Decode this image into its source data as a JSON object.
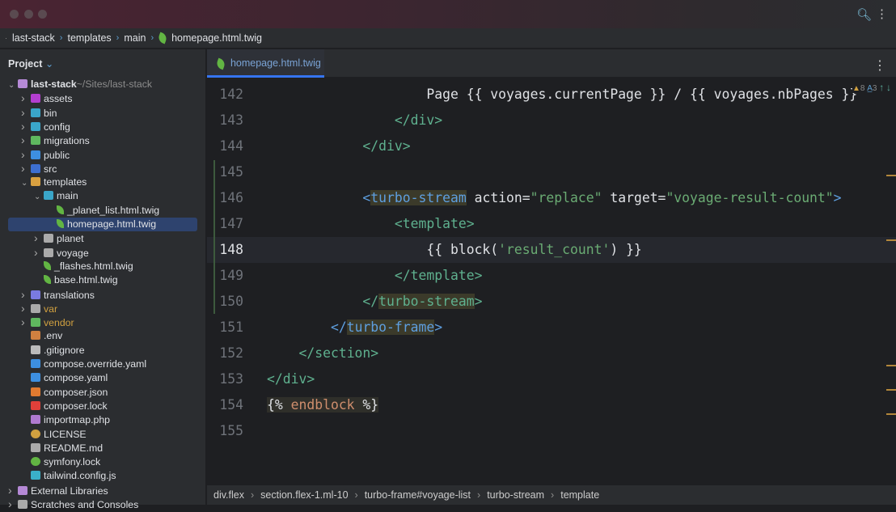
{
  "breadcrumb": [
    "last-stack",
    "templates",
    "main",
    "homepage.html.twig"
  ],
  "sidebar": {
    "title": "Project",
    "items": [
      {
        "label": "last-stack",
        "hint": "~/Sites/last-stack",
        "depth": 0,
        "chev": "v",
        "icon": "folder-icon",
        "color": "#b589d6",
        "bold": true
      },
      {
        "label": "assets",
        "depth": 1,
        "chev": ">",
        "icon": "folder-icon",
        "color": "#b33ecf"
      },
      {
        "label": "bin",
        "depth": 1,
        "chev": ">",
        "icon": "folder-icon",
        "color": "#3aa6c9"
      },
      {
        "label": "config",
        "depth": 1,
        "chev": ">",
        "icon": "folder-icon",
        "color": "#3aa6c9"
      },
      {
        "label": "migrations",
        "depth": 1,
        "chev": ">",
        "icon": "folder-icon",
        "color": "#5fb85f"
      },
      {
        "label": "public",
        "depth": 1,
        "chev": ">",
        "icon": "folder-icon",
        "color": "#3d8fe0"
      },
      {
        "label": "src",
        "depth": 1,
        "chev": ">",
        "icon": "folder-icon",
        "color": "#3d6fd0"
      },
      {
        "label": "templates",
        "depth": 1,
        "chev": "v",
        "icon": "folder-icon",
        "color": "#d8a040"
      },
      {
        "label": "main",
        "depth": 2,
        "chev": "v",
        "icon": "folder-icon",
        "color": "#3aa6c9"
      },
      {
        "label": "_planet_list.html.twig",
        "depth": 3,
        "icon": "twig-icon",
        "color": "#62b543"
      },
      {
        "label": "homepage.html.twig",
        "depth": 3,
        "icon": "twig-icon",
        "color": "#62b543",
        "selected": true
      },
      {
        "label": "planet",
        "depth": 2,
        "chev": ">",
        "icon": "folder-icon",
        "color": "#aaaaaa"
      },
      {
        "label": "voyage",
        "depth": 2,
        "chev": ">",
        "icon": "folder-icon",
        "color": "#aaaaaa"
      },
      {
        "label": "_flashes.html.twig",
        "depth": 2,
        "icon": "twig-icon",
        "color": "#62b543"
      },
      {
        "label": "base.html.twig",
        "depth": 2,
        "icon": "twig-icon",
        "color": "#62b543"
      },
      {
        "label": "translations",
        "depth": 1,
        "chev": ">",
        "icon": "folder-icon",
        "color": "#7a7ae0"
      },
      {
        "label": "var",
        "depth": 1,
        "chev": ">",
        "icon": "folder-icon",
        "color": "#aaaaaa",
        "textcolor": "#d0a040"
      },
      {
        "label": "vendor",
        "depth": 1,
        "chev": ">",
        "icon": "folder-icon",
        "color": "#5fb85f",
        "textcolor": "#d0a040"
      },
      {
        "label": ".env",
        "depth": 1,
        "icon": "env-icon",
        "color": "#d08040"
      },
      {
        "label": ".gitignore",
        "depth": 1,
        "icon": "git-icon",
        "color": "#bbbbbb"
      },
      {
        "label": "compose.override.yaml",
        "depth": 1,
        "icon": "docker-icon",
        "color": "#3d8fe0"
      },
      {
        "label": "compose.yaml",
        "depth": 1,
        "icon": "docker-icon",
        "color": "#3d8fe0"
      },
      {
        "label": "composer.json",
        "depth": 1,
        "icon": "composer-icon",
        "color": "#e07a30"
      },
      {
        "label": "composer.lock",
        "depth": 1,
        "icon": "lock-icon",
        "color": "#e0403a"
      },
      {
        "label": "importmap.php",
        "depth": 1,
        "icon": "php-icon",
        "color": "#b07ad0"
      },
      {
        "label": "LICENSE",
        "depth": 1,
        "icon": "license-icon",
        "color": "#d0a040"
      },
      {
        "label": "README.md",
        "depth": 1,
        "icon": "readme-icon",
        "color": "#aaaaaa"
      },
      {
        "label": "symfony.lock",
        "depth": 1,
        "icon": "symfony-icon",
        "color": "#62b543"
      },
      {
        "label": "tailwind.config.js",
        "depth": 1,
        "icon": "tailwind-icon",
        "color": "#3ab0c9"
      },
      {
        "label": "External Libraries",
        "depth": 0,
        "chev": ">",
        "icon": "library-icon",
        "color": "#b589d6"
      },
      {
        "label": "Scratches and Consoles",
        "depth": 0,
        "chev": ">",
        "icon": "scratch-icon",
        "color": "#aaaaaa"
      }
    ]
  },
  "editor": {
    "tab": "homepage.html.twig",
    "warnings": "8",
    "typos": "3",
    "current_line": 148,
    "lines": [
      {
        "n": 142,
        "tokens": [
          [
            "                    Page {{ voyages.currentPage }} / {{ voyages.nbPages }}",
            "t-twig"
          ]
        ]
      },
      {
        "n": 143,
        "tokens": [
          [
            "                ",
            ""
          ],
          [
            "</div>",
            "t-tag"
          ]
        ]
      },
      {
        "n": 144,
        "tokens": [
          [
            "            ",
            ""
          ],
          [
            "</div>",
            "t-tag"
          ]
        ]
      },
      {
        "n": 145,
        "tokens": []
      },
      {
        "n": 146,
        "tokens": [
          [
            "            ",
            ""
          ],
          [
            "<",
            "t-tn"
          ],
          [
            "turbo-stream",
            "t-tn t-hl"
          ],
          [
            " action=",
            "t-attr"
          ],
          [
            "\"replace\"",
            "t-str"
          ],
          [
            " target=",
            "t-attr"
          ],
          [
            "\"voyage-result-count\"",
            "t-str"
          ],
          [
            ">",
            "t-tn"
          ]
        ]
      },
      {
        "n": 147,
        "tokens": [
          [
            "                ",
            ""
          ],
          [
            "<template>",
            "t-tag"
          ]
        ]
      },
      {
        "n": 148,
        "tokens": [
          [
            "                    {{ block(",
            "t-twig"
          ],
          [
            "'result_count'",
            "t-str"
          ],
          [
            ") }}",
            "t-twig"
          ]
        ]
      },
      {
        "n": 149,
        "tokens": [
          [
            "                ",
            ""
          ],
          [
            "</template>",
            "t-tag"
          ]
        ]
      },
      {
        "n": 150,
        "tokens": [
          [
            "            ",
            ""
          ],
          [
            "</",
            "t-tag"
          ],
          [
            "turbo-stream",
            "t-tag t-hl"
          ],
          [
            ">",
            "t-tag"
          ]
        ]
      },
      {
        "n": 151,
        "tokens": [
          [
            "        ",
            ""
          ],
          [
            "</",
            "t-tn"
          ],
          [
            "turbo-frame",
            "t-tn t-hl"
          ],
          [
            ">",
            "t-tn"
          ]
        ]
      },
      {
        "n": 152,
        "tokens": [
          [
            "    ",
            ""
          ],
          [
            "</section>",
            "t-tag"
          ]
        ]
      },
      {
        "n": 153,
        "tokens": [
          [
            "",
            ""
          ],
          [
            "</div>",
            "t-tag"
          ]
        ]
      },
      {
        "n": 154,
        "tokens": [
          [
            "{% ",
            "t-twig t-twbg"
          ],
          [
            "endblock",
            "t-kw t-twbg"
          ],
          [
            " %}",
            "t-twig t-twbg"
          ]
        ]
      },
      {
        "n": 155,
        "tokens": []
      }
    ]
  },
  "status_path": [
    "div.flex",
    "section.flex-1.ml-10",
    "turbo-frame#voyage-list",
    "turbo-stream",
    "template"
  ]
}
